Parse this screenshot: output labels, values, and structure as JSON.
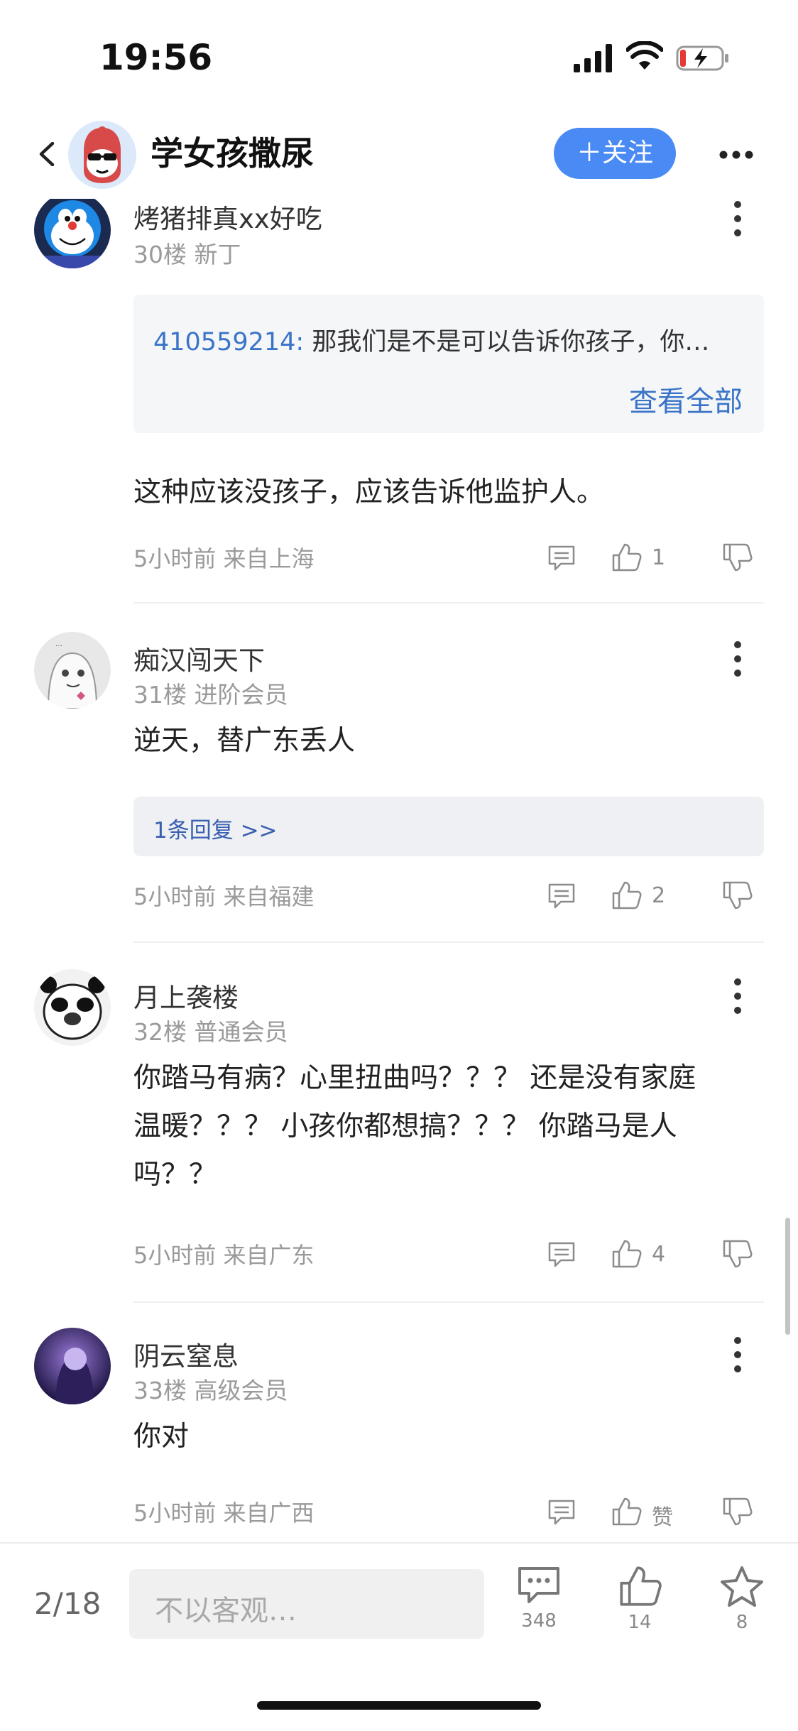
{
  "status_bar": {
    "time": "19:56"
  },
  "header": {
    "title": "学女孩撒尿",
    "follow_label": "＋关注"
  },
  "comments": [
    {
      "username": "烤猪排真xx好吃",
      "floor": "30楼",
      "member": "新丁",
      "quote": {
        "user_id": "410559214:",
        "text": " 那我们是不是可以告诉你孩子，你…",
        "see_all": "查看全部"
      },
      "text": "这种应该没孩子，应该告诉他监护人。",
      "time_location": "5小时前 来自上海",
      "likes": "1"
    },
    {
      "username": "痴汉闯天下",
      "floor": "31楼",
      "member": "进阶会员",
      "text": "逆天，替广东丢人",
      "replies_label": "1条回复 >>",
      "time_location": "5小时前 来自福建",
      "likes": "2"
    },
    {
      "username": "月上袭楼",
      "floor": "32楼",
      "member": "普通会员",
      "text_lines": [
        "你踏马有病？心里扭曲吗？？？ 还是没有家庭",
        "温暖？？？ 小孩你都想搞？？？ 你踏马是人",
        "吗？？"
      ],
      "time_location": "5小时前 来自广东",
      "likes": "4"
    },
    {
      "username": "阴云窒息",
      "floor": "33楼",
      "member": "高级会员",
      "text": "你对",
      "time_location": "5小时前 来自广西",
      "likes": "赞"
    }
  ],
  "bottom_bar": {
    "page": "2/18",
    "input_placeholder": "不以客观…",
    "comments_count": "348",
    "likes_count": "14",
    "favorites_count": "8"
  },
  "icons": {
    "back": "back-arrow-icon",
    "more": "more-horizontal-icon",
    "kebab": "more-vertical-icon",
    "reply": "comment-bubble-icon",
    "like": "thumbs-up-icon",
    "dislike": "thumbs-down-icon",
    "favorite": "star-icon"
  },
  "colors": {
    "accent": "#4a8af4",
    "link": "#3a74c8"
  }
}
